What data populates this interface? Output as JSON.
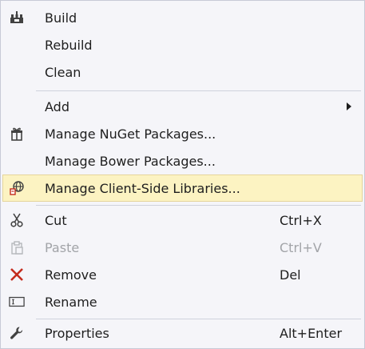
{
  "menu": {
    "items": [
      {
        "label": "Build",
        "icon": "build-icon"
      },
      {
        "label": "Rebuild"
      },
      {
        "label": "Clean"
      },
      {
        "label": "Add",
        "submenu": true
      },
      {
        "label": "Manage NuGet Packages...",
        "icon": "nuget-package-icon"
      },
      {
        "label": "Manage Bower Packages..."
      },
      {
        "label": "Manage Client-Side Libraries...",
        "icon": "client-side-library-icon",
        "highlighted": true
      },
      {
        "label": "Cut",
        "shortcut": "Ctrl+X",
        "icon": "scissors-icon"
      },
      {
        "label": "Paste",
        "shortcut": "Ctrl+V",
        "icon": "paste-icon",
        "disabled": true
      },
      {
        "label": "Remove",
        "shortcut": "Del",
        "icon": "remove-x-icon"
      },
      {
        "label": "Rename",
        "icon": "rename-icon"
      },
      {
        "label": "Properties",
        "shortcut": "Alt+Enter",
        "icon": "wrench-icon"
      }
    ]
  },
  "colors": {
    "highlight_bg": "#fcf3c2",
    "remove_red": "#c42b1c",
    "text": "#1e1e1e",
    "disabled_text": "#a2a4a8"
  }
}
